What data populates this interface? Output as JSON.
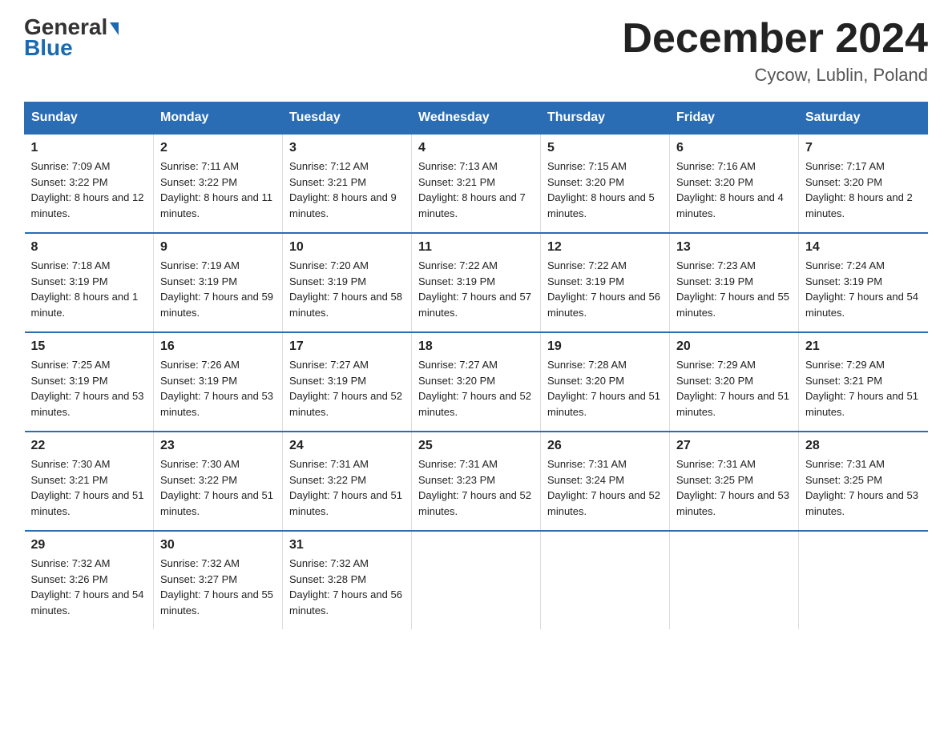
{
  "logo": {
    "part1": "General",
    "part2": "Blue"
  },
  "title": "December 2024",
  "location": "Cycow, Lublin, Poland",
  "days_of_week": [
    "Sunday",
    "Monday",
    "Tuesday",
    "Wednesday",
    "Thursday",
    "Friday",
    "Saturday"
  ],
  "weeks": [
    [
      {
        "day": "1",
        "sunrise": "7:09 AM",
        "sunset": "3:22 PM",
        "daylight": "8 hours and 12 minutes."
      },
      {
        "day": "2",
        "sunrise": "7:11 AM",
        "sunset": "3:22 PM",
        "daylight": "8 hours and 11 minutes."
      },
      {
        "day": "3",
        "sunrise": "7:12 AM",
        "sunset": "3:21 PM",
        "daylight": "8 hours and 9 minutes."
      },
      {
        "day": "4",
        "sunrise": "7:13 AM",
        "sunset": "3:21 PM",
        "daylight": "8 hours and 7 minutes."
      },
      {
        "day": "5",
        "sunrise": "7:15 AM",
        "sunset": "3:20 PM",
        "daylight": "8 hours and 5 minutes."
      },
      {
        "day": "6",
        "sunrise": "7:16 AM",
        "sunset": "3:20 PM",
        "daylight": "8 hours and 4 minutes."
      },
      {
        "day": "7",
        "sunrise": "7:17 AM",
        "sunset": "3:20 PM",
        "daylight": "8 hours and 2 minutes."
      }
    ],
    [
      {
        "day": "8",
        "sunrise": "7:18 AM",
        "sunset": "3:19 PM",
        "daylight": "8 hours and 1 minute."
      },
      {
        "day": "9",
        "sunrise": "7:19 AM",
        "sunset": "3:19 PM",
        "daylight": "7 hours and 59 minutes."
      },
      {
        "day": "10",
        "sunrise": "7:20 AM",
        "sunset": "3:19 PM",
        "daylight": "7 hours and 58 minutes."
      },
      {
        "day": "11",
        "sunrise": "7:22 AM",
        "sunset": "3:19 PM",
        "daylight": "7 hours and 57 minutes."
      },
      {
        "day": "12",
        "sunrise": "7:22 AM",
        "sunset": "3:19 PM",
        "daylight": "7 hours and 56 minutes."
      },
      {
        "day": "13",
        "sunrise": "7:23 AM",
        "sunset": "3:19 PM",
        "daylight": "7 hours and 55 minutes."
      },
      {
        "day": "14",
        "sunrise": "7:24 AM",
        "sunset": "3:19 PM",
        "daylight": "7 hours and 54 minutes."
      }
    ],
    [
      {
        "day": "15",
        "sunrise": "7:25 AM",
        "sunset": "3:19 PM",
        "daylight": "7 hours and 53 minutes."
      },
      {
        "day": "16",
        "sunrise": "7:26 AM",
        "sunset": "3:19 PM",
        "daylight": "7 hours and 53 minutes."
      },
      {
        "day": "17",
        "sunrise": "7:27 AM",
        "sunset": "3:19 PM",
        "daylight": "7 hours and 52 minutes."
      },
      {
        "day": "18",
        "sunrise": "7:27 AM",
        "sunset": "3:20 PM",
        "daylight": "7 hours and 52 minutes."
      },
      {
        "day": "19",
        "sunrise": "7:28 AM",
        "sunset": "3:20 PM",
        "daylight": "7 hours and 51 minutes."
      },
      {
        "day": "20",
        "sunrise": "7:29 AM",
        "sunset": "3:20 PM",
        "daylight": "7 hours and 51 minutes."
      },
      {
        "day": "21",
        "sunrise": "7:29 AM",
        "sunset": "3:21 PM",
        "daylight": "7 hours and 51 minutes."
      }
    ],
    [
      {
        "day": "22",
        "sunrise": "7:30 AM",
        "sunset": "3:21 PM",
        "daylight": "7 hours and 51 minutes."
      },
      {
        "day": "23",
        "sunrise": "7:30 AM",
        "sunset": "3:22 PM",
        "daylight": "7 hours and 51 minutes."
      },
      {
        "day": "24",
        "sunrise": "7:31 AM",
        "sunset": "3:22 PM",
        "daylight": "7 hours and 51 minutes."
      },
      {
        "day": "25",
        "sunrise": "7:31 AM",
        "sunset": "3:23 PM",
        "daylight": "7 hours and 52 minutes."
      },
      {
        "day": "26",
        "sunrise": "7:31 AM",
        "sunset": "3:24 PM",
        "daylight": "7 hours and 52 minutes."
      },
      {
        "day": "27",
        "sunrise": "7:31 AM",
        "sunset": "3:25 PM",
        "daylight": "7 hours and 53 minutes."
      },
      {
        "day": "28",
        "sunrise": "7:31 AM",
        "sunset": "3:25 PM",
        "daylight": "7 hours and 53 minutes."
      }
    ],
    [
      {
        "day": "29",
        "sunrise": "7:32 AM",
        "sunset": "3:26 PM",
        "daylight": "7 hours and 54 minutes."
      },
      {
        "day": "30",
        "sunrise": "7:32 AM",
        "sunset": "3:27 PM",
        "daylight": "7 hours and 55 minutes."
      },
      {
        "day": "31",
        "sunrise": "7:32 AM",
        "sunset": "3:28 PM",
        "daylight": "7 hours and 56 minutes."
      },
      null,
      null,
      null,
      null
    ]
  ]
}
